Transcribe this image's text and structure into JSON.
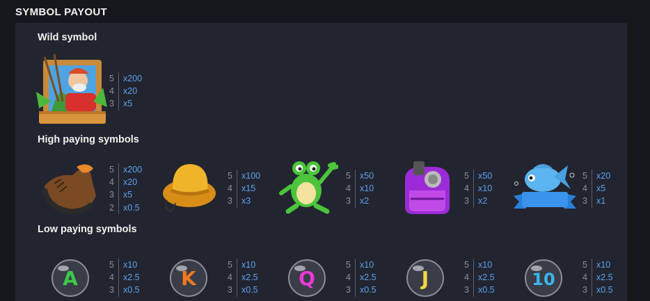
{
  "header": {
    "title": "SYMBOL PAYOUT"
  },
  "sections": {
    "wild": "Wild symbol",
    "high": "High paying symbols",
    "low": "Low paying symbols"
  },
  "wild_symbol": {
    "icon": "fisherman-wild-icon",
    "pays": [
      {
        "count": "5",
        "mult": "x200"
      },
      {
        "count": "4",
        "mult": "x20"
      },
      {
        "count": "3",
        "mult": "x5"
      }
    ]
  },
  "high_symbols": [
    {
      "icon": "boot-icon",
      "pays": [
        {
          "count": "5",
          "mult": "x200"
        },
        {
          "count": "4",
          "mult": "x20"
        },
        {
          "count": "3",
          "mult": "x5"
        },
        {
          "count": "2",
          "mult": "x0.5"
        }
      ]
    },
    {
      "icon": "hat-icon",
      "pays": [
        {
          "count": "5",
          "mult": "x100"
        },
        {
          "count": "4",
          "mult": "x15"
        },
        {
          "count": "3",
          "mult": "x3"
        }
      ]
    },
    {
      "icon": "frog-icon",
      "pays": [
        {
          "count": "5",
          "mult": "x50"
        },
        {
          "count": "4",
          "mult": "x10"
        },
        {
          "count": "3",
          "mult": "x2"
        }
      ]
    },
    {
      "icon": "backpack-icon",
      "pays": [
        {
          "count": "5",
          "mult": "x50"
        },
        {
          "count": "4",
          "mult": "x10"
        },
        {
          "count": "3",
          "mult": "x2"
        }
      ]
    },
    {
      "icon": "fish-icon",
      "pays": [
        {
          "count": "5",
          "mult": "x20"
        },
        {
          "count": "4",
          "mult": "x5"
        },
        {
          "count": "3",
          "mult": "x1"
        }
      ]
    }
  ],
  "low_symbols": [
    {
      "icon": "letter-a-icon",
      "letter": "A",
      "color": "#3cc84a",
      "pays": [
        {
          "count": "5",
          "mult": "x10"
        },
        {
          "count": "4",
          "mult": "x2.5"
        },
        {
          "count": "3",
          "mult": "x0.5"
        }
      ]
    },
    {
      "icon": "letter-k-icon",
      "letter": "K",
      "color": "#f27a1e",
      "pays": [
        {
          "count": "5",
          "mult": "x10"
        },
        {
          "count": "4",
          "mult": "x2.5"
        },
        {
          "count": "3",
          "mult": "x0.5"
        }
      ]
    },
    {
      "icon": "letter-q-icon",
      "letter": "Q",
      "color": "#e83ad6",
      "pays": [
        {
          "count": "5",
          "mult": "x10"
        },
        {
          "count": "4",
          "mult": "x2.5"
        },
        {
          "count": "3",
          "mult": "x0.5"
        }
      ]
    },
    {
      "icon": "letter-j-icon",
      "letter": "J",
      "color": "#f5d640",
      "pays": [
        {
          "count": "5",
          "mult": "x10"
        },
        {
          "count": "4",
          "mult": "x2.5"
        },
        {
          "count": "3",
          "mult": "x0.5"
        }
      ]
    },
    {
      "icon": "number-10-icon",
      "letter": "10",
      "color": "#3cb6f0",
      "pays": [
        {
          "count": "5",
          "mult": "x10"
        },
        {
          "count": "4",
          "mult": "x2.5"
        },
        {
          "count": "3",
          "mult": "x0.5"
        }
      ]
    }
  ]
}
